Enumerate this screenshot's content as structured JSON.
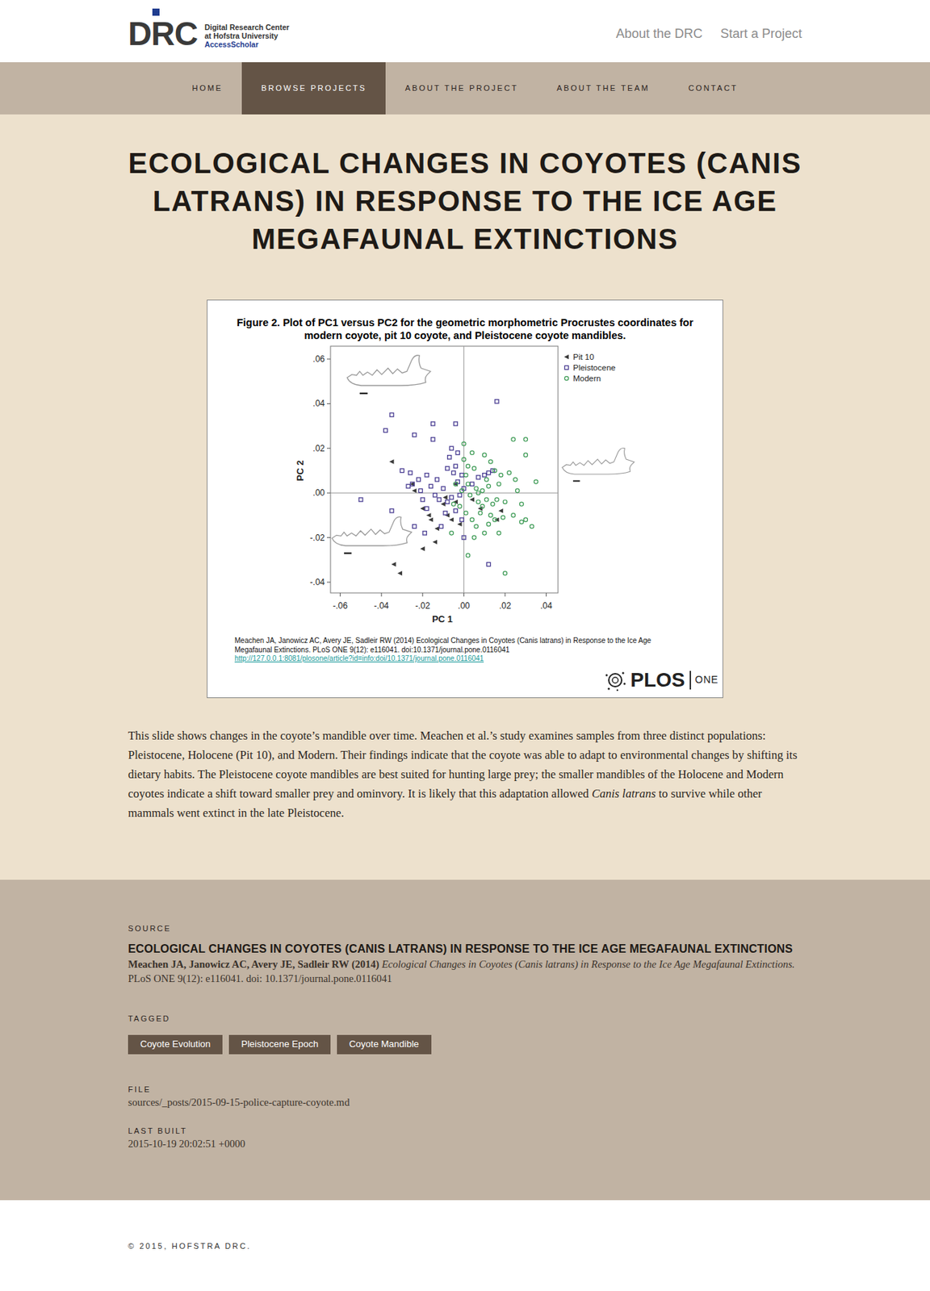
{
  "header": {
    "logo": {
      "letters": [
        "D",
        "R",
        "C"
      ],
      "lines": [
        "Digital Research Center",
        "at Hofstra University",
        "AccessScholar"
      ]
    },
    "links": [
      "About the DRC",
      "Start a Project"
    ]
  },
  "nav": [
    {
      "label": "HOME",
      "selected": false
    },
    {
      "label": "BROWSE PROJECTS",
      "selected": true
    },
    {
      "label": "ABOUT THE PROJECT",
      "selected": false
    },
    {
      "label": "ABOUT THE TEAM",
      "selected": false
    },
    {
      "label": "CONTACT",
      "selected": false
    }
  ],
  "title": "ECOLOGICAL CHANGES IN COYOTES (CANIS LATRANS) IN RESPONSE TO THE ICE AGE MEGAFAUNAL EXTINCTIONS",
  "figure": {
    "title_lines": [
      "Figure 2. Plot of PC1 versus PC2 for the geometric morphometric Procrustes coordinates for",
      "modern coyote, pit 10 coyote, and Pleistocene coyote mandibles."
    ],
    "chart": {
      "y_label": "PC 2",
      "x_label": "PC 1",
      "y_ticks": [
        ".06",
        ".04",
        ".02",
        ".00",
        "-.02",
        "-.04"
      ],
      "x_ticks": [
        "-.06",
        "-.04",
        "-.02",
        ".00",
        ".02",
        ".04"
      ],
      "series": [
        {
          "name": "Pit 10",
          "kind": "triangle",
          "color": "#3a3a3a",
          "x": [
            -0.035,
            -0.025,
            -0.024,
            -0.02,
            -0.016,
            -0.008,
            -0.01,
            -0.004,
            -0.006,
            -0.013,
            -0.02,
            -0.014,
            -0.002,
            0.008,
            0.016,
            0.018,
            -0.034,
            -0.031,
            -0.009,
            0.004,
            -0.017,
            -0.004
          ],
          "y": [
            0.014,
            0.004,
            0.001,
            -0.007,
            -0.012,
            -0.01,
            -0.005,
            -0.004,
            -0.012,
            -0.016,
            -0.025,
            -0.022,
            -0.014,
            -0.007,
            -0.012,
            -0.008,
            -0.032,
            -0.036,
            -0.002,
            -0.003,
            -0.01,
            0.004
          ]
        },
        {
          "name": "Pleistocene",
          "kind": "square",
          "color": "#4b3f93",
          "x": [
            -0.035,
            -0.038,
            -0.024,
            -0.015,
            -0.004,
            -0.006,
            -0.015,
            0.016,
            -0.007,
            -0.026,
            -0.022,
            -0.03,
            -0.018,
            -0.013,
            -0.008,
            -0.005,
            -0.01,
            -0.016,
            -0.021,
            -0.025,
            -0.012,
            -0.006,
            -0.003,
            -0.008,
            0.0,
            -0.002,
            0.004,
            0.01,
            0.012,
            0.014,
            -0.05,
            -0.035,
            -0.018,
            -0.009,
            -0.004,
            -0.001,
            -0.011,
            -0.019,
            -0.024,
            0.0,
            0.012,
            -0.003,
            -0.027,
            -0.014,
            -0.02,
            0.007,
            -0.004,
            -0.001
          ],
          "y": [
            0.035,
            0.028,
            0.026,
            0.031,
            0.031,
            0.02,
            0.024,
            0.041,
            0.016,
            0.009,
            0.006,
            0.01,
            0.008,
            0.006,
            0.011,
            0.009,
            0.002,
            0.003,
            0.001,
            0.004,
            -0.003,
            -0.002,
            0.005,
            -0.004,
            0.002,
            -0.001,
            0.004,
            0.008,
            0.009,
            0.01,
            -0.003,
            -0.008,
            -0.007,
            -0.009,
            -0.008,
            -0.012,
            -0.015,
            -0.018,
            -0.015,
            -0.02,
            -0.032,
            0.018,
            0.003,
            -0.001,
            -0.003,
            0.007,
            0.012,
            0.008
          ]
        },
        {
          "name": "Modern",
          "kind": "circle",
          "color": "#3c9a54",
          "x": [
            0.0,
            0.004,
            0.01,
            0.013,
            0.024,
            0.03,
            0.03,
            0.015,
            0.018,
            0.022,
            0.025,
            0.035,
            0.026,
            0.002,
            0.005,
            0.001,
            -0.004,
            0.002,
            0.006,
            0.009,
            0.012,
            0.017,
            0.003,
            0.007,
            0.011,
            0.014,
            0.016,
            0.02,
            0.028,
            -0.002,
            0.001,
            0.004,
            0.008,
            0.012,
            0.015,
            0.019,
            0.028,
            0.03,
            0.033,
            0.024,
            0.01,
            0.005,
            -0.006,
            0.002,
            0.02,
            0.009,
            0.013,
            -0.005,
            0.006,
            0.017,
            0.0,
            0.007,
            0.011,
            -0.001
          ],
          "y": [
            0.022,
            0.018,
            0.017,
            0.014,
            0.024,
            0.024,
            0.017,
            0.01,
            0.008,
            0.009,
            0.006,
            0.005,
            0.001,
            0.012,
            0.011,
            0.008,
            0.004,
            0.004,
            0.002,
            0.001,
            0.003,
            0.004,
            -0.001,
            -0.004,
            -0.003,
            -0.005,
            -0.003,
            -0.004,
            -0.005,
            -0.006,
            -0.009,
            -0.012,
            -0.009,
            -0.014,
            -0.012,
            -0.011,
            -0.013,
            -0.012,
            -0.015,
            -0.01,
            -0.018,
            -0.02,
            -0.018,
            -0.028,
            -0.036,
            -0.006,
            -0.01,
            -0.005,
            -0.015,
            -0.018,
            0.015,
            0.0,
            0.006,
            0.001
          ]
        }
      ]
    },
    "citation_lines": [
      "Meachen JA, Janowicz AC, Avery JE, Sadleir RW (2014) Ecological Changes in Coyotes (Canis latrans) in Response to the Ice Age",
      "Megafaunal Extinctions. PLoS ONE 9(12): e116041. doi:10.1371/journal.pone.0116041"
    ],
    "link": "http://127.0.0.1:8081/plosone/article?id=info:doi/10.1371/journal.pone.0116041",
    "publisher": {
      "name": "PLOS",
      "journal": "ONE"
    }
  },
  "description": [
    {
      "text": "This slide shows changes in the coyote’s mandible over time. Meachen et al.’s study examines samples from three distinct populations: Pleistocene, Holocene (Pit 10), and Modern. Their findings indicate that the coyote was able to adapt to environmental changes by shifting its dietary habits. The Pleistocene coyote mandibles are best suited for hunting large prey; the smaller mandibles of the Holocene and Modern coyotes indicate a shift toward smaller prey and ominvory. It is likely that this adaptation allowed ",
      "italic": false
    },
    {
      "text": "Canis latrans",
      "italic": true
    },
    {
      "text": " to survive while other mammals went extinct in the late Pleistocene.",
      "italic": false
    }
  ],
  "source": {
    "label": "SOURCE",
    "title": "ECOLOGICAL CHANGES IN COYOTES (CANIS LATRANS) IN RESPONSE TO THE ICE AGE MEGAFAUNAL EXTINCTIONS",
    "authors": "Meachen JA, Janowicz AC, Avery JE, Sadleir RW (2014)",
    "article": "Ecological Changes in Coyotes (Canis latrans) in Response to the Ice Age Megafaunal Extinctions.",
    "journal": "PLoS ONE 9(12): e116041. doi: 10.1371/journal.pone.0116041"
  },
  "tagged": {
    "label": "TAGGED",
    "tags": [
      "Coyote Evolution",
      "Pleistocene Epoch",
      "Coyote Mandible"
    ]
  },
  "file": {
    "label": "FILE",
    "value": "sources/_posts/2015-09-15-police-capture-coyote.md"
  },
  "last_built": {
    "label": "LAST BUILT",
    "value": "2015-10-19 20:02:51 +0000"
  },
  "footer": "© 2015, HOFSTRA DRC."
}
